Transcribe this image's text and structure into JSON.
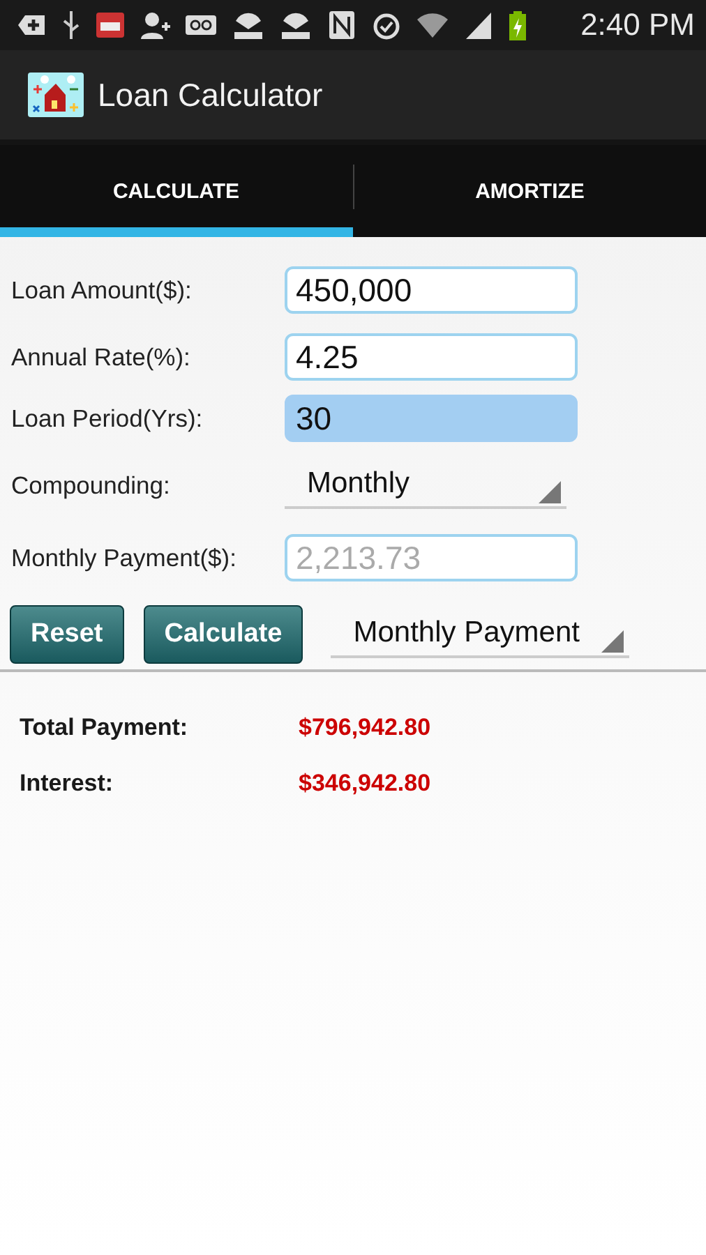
{
  "status_bar": {
    "time": "2:40 PM"
  },
  "app_bar": {
    "title": "Loan Calculator"
  },
  "tabs": [
    {
      "label": "CALCULATE",
      "selected": true
    },
    {
      "label": "AMORTIZE",
      "selected": false
    }
  ],
  "form": [
    {
      "kind": "input",
      "label": "Loan Amount($):",
      "value": "450,000",
      "focused": false,
      "disabled": false
    },
    {
      "kind": "input",
      "label": "Annual Rate(%):",
      "value": "4.25",
      "focused": false,
      "disabled": false
    },
    {
      "kind": "input",
      "label": "Loan Period(Yrs):",
      "value": "30",
      "focused": true,
      "disabled": false
    },
    {
      "kind": "dropdown",
      "label": "Compounding:",
      "value": "Monthly"
    },
    {
      "kind": "input",
      "label": "Monthly Payment($):",
      "value": "2,213.73",
      "focused": false,
      "disabled": true
    }
  ],
  "buttons": [
    "Reset",
    "Calculate"
  ],
  "mode_dropdown": {
    "value": "Monthly Payment"
  },
  "results": [
    {
      "label": "Total Payment:",
      "value": "$796,942.80"
    },
    {
      "label": "Interest:",
      "value": "$346,942.80"
    }
  ]
}
